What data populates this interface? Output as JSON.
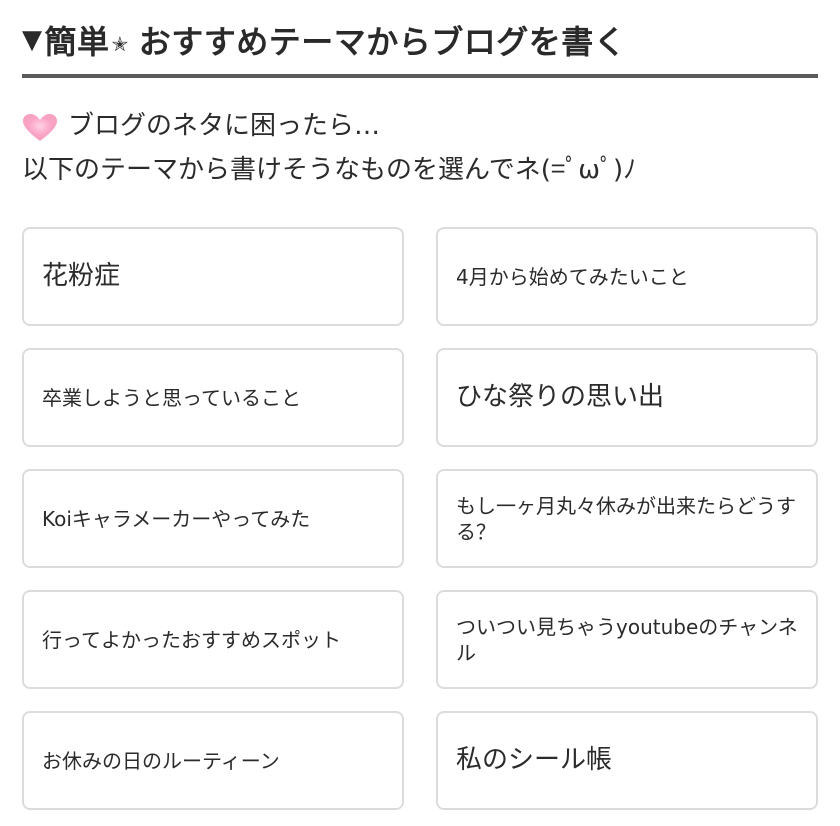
{
  "header": {
    "marker": "▼",
    "title_prefix": "簡単",
    "star": "✭",
    "title": "おすすめテーマからブログを書く"
  },
  "intro": {
    "heart_icon": "heart-icon",
    "line1": "ブログのネタに困ったら…",
    "line2": "以下のテーマから書けそうなものを選んでネ(=ﾟωﾟ)ﾉ"
  },
  "themes": [
    {
      "label": "花粉症"
    },
    {
      "label": "4月から始めてみたいこと"
    },
    {
      "label": "卒業しようと思っていること"
    },
    {
      "label": "ひな祭りの思い出"
    },
    {
      "label": "Koiキャラメーカーやってみた"
    },
    {
      "label": "もし一ヶ月丸々休みが出来たらどうする？"
    },
    {
      "label": "行ってよかったおすすめスポット"
    },
    {
      "label": "ついつい見ちゃうyoutubeのチャンネル"
    },
    {
      "label": "お休みの日のルーティーン"
    },
    {
      "label": "私のシール帳"
    }
  ],
  "colors": {
    "divider": "#5a5a5a",
    "card_border": "#dcdcdc",
    "heart": "#f48fb1"
  }
}
